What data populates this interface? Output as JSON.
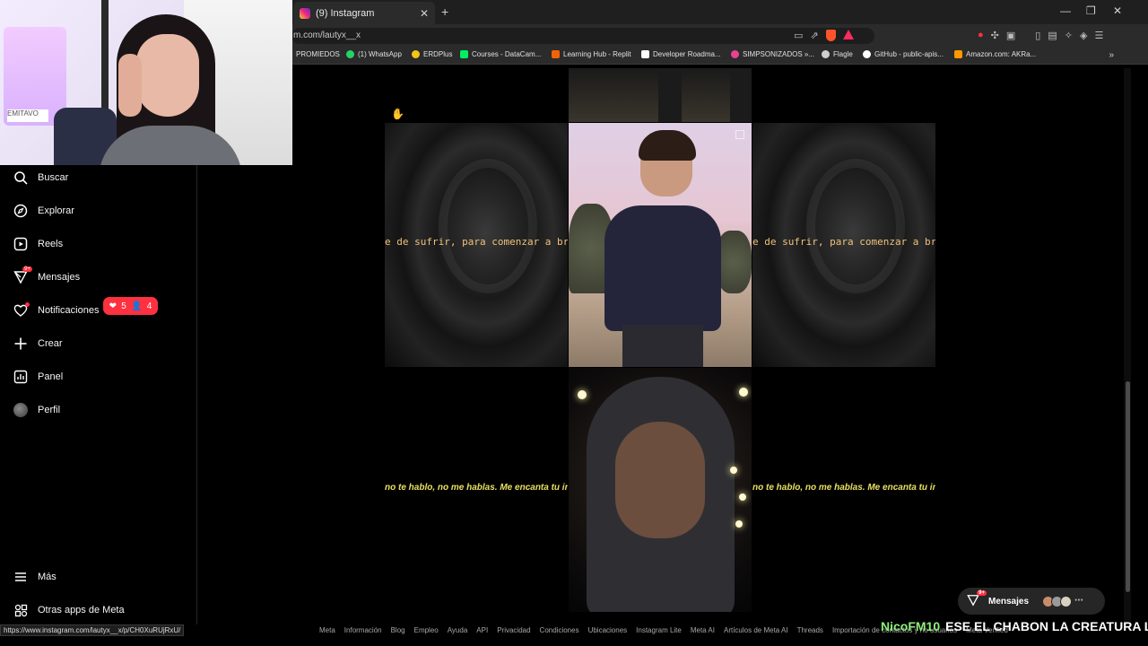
{
  "browser": {
    "tab_title": "(9) Instagram",
    "url": "m.com/lautyx__x",
    "bookmarks": [
      {
        "label": "PROMIEDOS",
        "color": "#2e7d32"
      },
      {
        "label": "(1) WhatsApp",
        "color": "#25d366"
      },
      {
        "label": "ERDPlus",
        "color": "#f5c518"
      },
      {
        "label": "Courses - DataCam...",
        "color": "#03ef62"
      },
      {
        "label": "Learning Hub - Replit",
        "color": "#f26207"
      },
      {
        "label": "Developer Roadma...",
        "color": "#ffffff"
      },
      {
        "label": "SIMPSONIZADOS »...",
        "color": "#e84393"
      },
      {
        "label": "Flagle",
        "color": "#cfcfcf"
      },
      {
        "label": "GitHub - public-apis...",
        "color": "#ffffff"
      },
      {
        "label": "Amazon.com: AKRa...",
        "color": "#ff9900"
      }
    ],
    "status_url": "https://www.instagram.com/lautyx__x/p/CH0XuRUjRxU/"
  },
  "sidebar": {
    "items": [
      {
        "label": "Buscar",
        "icon": "search-icon"
      },
      {
        "label": "Explorar",
        "icon": "compass-icon"
      },
      {
        "label": "Reels",
        "icon": "reels-icon"
      },
      {
        "label": "Mensajes",
        "icon": "messenger-icon",
        "badge": "9+"
      },
      {
        "label": "Notificaciones",
        "icon": "heart-icon"
      },
      {
        "label": "Crear",
        "icon": "plus-icon"
      },
      {
        "label": "Panel",
        "icon": "chart-icon"
      },
      {
        "label": "Perfil",
        "icon": "avatar"
      }
    ],
    "notifications": {
      "likes": "5",
      "followers": "4"
    },
    "more_label": "Más",
    "meta_apps_label": "Otras apps de Meta"
  },
  "posts": {
    "rose_text": "e de sufrir, para comenzar a bril",
    "quote_text": "no te hablo, no me hablas. Me encanta tu inter"
  },
  "footer_links": [
    "Meta",
    "Información",
    "Blog",
    "Empleo",
    "Ayuda",
    "API",
    "Privacidad",
    "Condiciones",
    "Ubicaciones",
    "Instagram Lite",
    "Meta AI",
    "Artículos de Meta AI",
    "Threads",
    "Importación de contactos y no usuarios",
    "Meta Verified"
  ],
  "messages_pill": {
    "label": "Mensajes",
    "badge": "9+"
  },
  "stream_chat": {
    "user": "NicoFM10",
    "text": "ESE EL CHABON LA CREATURA LO"
  },
  "cam": {
    "sign": "EMITAVO"
  },
  "colors": {
    "accent_red": "#ff3040",
    "chat_user": "#8ef07a",
    "quote_yellow": "#e8e060"
  }
}
